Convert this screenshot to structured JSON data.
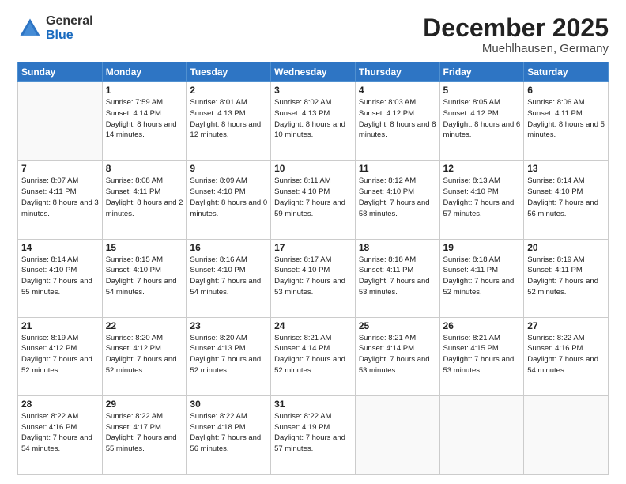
{
  "logo": {
    "general": "General",
    "blue": "Blue"
  },
  "title": "December 2025",
  "location": "Muehlhausen, Germany",
  "days_header": [
    "Sunday",
    "Monday",
    "Tuesday",
    "Wednesday",
    "Thursday",
    "Friday",
    "Saturday"
  ],
  "weeks": [
    [
      {
        "day": "",
        "sunrise": "",
        "sunset": "",
        "daylight": ""
      },
      {
        "day": "1",
        "sunrise": "Sunrise: 7:59 AM",
        "sunset": "Sunset: 4:14 PM",
        "daylight": "Daylight: 8 hours and 14 minutes."
      },
      {
        "day": "2",
        "sunrise": "Sunrise: 8:01 AM",
        "sunset": "Sunset: 4:13 PM",
        "daylight": "Daylight: 8 hours and 12 minutes."
      },
      {
        "day": "3",
        "sunrise": "Sunrise: 8:02 AM",
        "sunset": "Sunset: 4:13 PM",
        "daylight": "Daylight: 8 hours and 10 minutes."
      },
      {
        "day": "4",
        "sunrise": "Sunrise: 8:03 AM",
        "sunset": "Sunset: 4:12 PM",
        "daylight": "Daylight: 8 hours and 8 minutes."
      },
      {
        "day": "5",
        "sunrise": "Sunrise: 8:05 AM",
        "sunset": "Sunset: 4:12 PM",
        "daylight": "Daylight: 8 hours and 6 minutes."
      },
      {
        "day": "6",
        "sunrise": "Sunrise: 8:06 AM",
        "sunset": "Sunset: 4:11 PM",
        "daylight": "Daylight: 8 hours and 5 minutes."
      }
    ],
    [
      {
        "day": "7",
        "sunrise": "Sunrise: 8:07 AM",
        "sunset": "Sunset: 4:11 PM",
        "daylight": "Daylight: 8 hours and 3 minutes."
      },
      {
        "day": "8",
        "sunrise": "Sunrise: 8:08 AM",
        "sunset": "Sunset: 4:11 PM",
        "daylight": "Daylight: 8 hours and 2 minutes."
      },
      {
        "day": "9",
        "sunrise": "Sunrise: 8:09 AM",
        "sunset": "Sunset: 4:10 PM",
        "daylight": "Daylight: 8 hours and 0 minutes."
      },
      {
        "day": "10",
        "sunrise": "Sunrise: 8:11 AM",
        "sunset": "Sunset: 4:10 PM",
        "daylight": "Daylight: 7 hours and 59 minutes."
      },
      {
        "day": "11",
        "sunrise": "Sunrise: 8:12 AM",
        "sunset": "Sunset: 4:10 PM",
        "daylight": "Daylight: 7 hours and 58 minutes."
      },
      {
        "day": "12",
        "sunrise": "Sunrise: 8:13 AM",
        "sunset": "Sunset: 4:10 PM",
        "daylight": "Daylight: 7 hours and 57 minutes."
      },
      {
        "day": "13",
        "sunrise": "Sunrise: 8:14 AM",
        "sunset": "Sunset: 4:10 PM",
        "daylight": "Daylight: 7 hours and 56 minutes."
      }
    ],
    [
      {
        "day": "14",
        "sunrise": "Sunrise: 8:14 AM",
        "sunset": "Sunset: 4:10 PM",
        "daylight": "Daylight: 7 hours and 55 minutes."
      },
      {
        "day": "15",
        "sunrise": "Sunrise: 8:15 AM",
        "sunset": "Sunset: 4:10 PM",
        "daylight": "Daylight: 7 hours and 54 minutes."
      },
      {
        "day": "16",
        "sunrise": "Sunrise: 8:16 AM",
        "sunset": "Sunset: 4:10 PM",
        "daylight": "Daylight: 7 hours and 54 minutes."
      },
      {
        "day": "17",
        "sunrise": "Sunrise: 8:17 AM",
        "sunset": "Sunset: 4:10 PM",
        "daylight": "Daylight: 7 hours and 53 minutes."
      },
      {
        "day": "18",
        "sunrise": "Sunrise: 8:18 AM",
        "sunset": "Sunset: 4:11 PM",
        "daylight": "Daylight: 7 hours and 53 minutes."
      },
      {
        "day": "19",
        "sunrise": "Sunrise: 8:18 AM",
        "sunset": "Sunset: 4:11 PM",
        "daylight": "Daylight: 7 hours and 52 minutes."
      },
      {
        "day": "20",
        "sunrise": "Sunrise: 8:19 AM",
        "sunset": "Sunset: 4:11 PM",
        "daylight": "Daylight: 7 hours and 52 minutes."
      }
    ],
    [
      {
        "day": "21",
        "sunrise": "Sunrise: 8:19 AM",
        "sunset": "Sunset: 4:12 PM",
        "daylight": "Daylight: 7 hours and 52 minutes."
      },
      {
        "day": "22",
        "sunrise": "Sunrise: 8:20 AM",
        "sunset": "Sunset: 4:12 PM",
        "daylight": "Daylight: 7 hours and 52 minutes."
      },
      {
        "day": "23",
        "sunrise": "Sunrise: 8:20 AM",
        "sunset": "Sunset: 4:13 PM",
        "daylight": "Daylight: 7 hours and 52 minutes."
      },
      {
        "day": "24",
        "sunrise": "Sunrise: 8:21 AM",
        "sunset": "Sunset: 4:14 PM",
        "daylight": "Daylight: 7 hours and 52 minutes."
      },
      {
        "day": "25",
        "sunrise": "Sunrise: 8:21 AM",
        "sunset": "Sunset: 4:14 PM",
        "daylight": "Daylight: 7 hours and 53 minutes."
      },
      {
        "day": "26",
        "sunrise": "Sunrise: 8:21 AM",
        "sunset": "Sunset: 4:15 PM",
        "daylight": "Daylight: 7 hours and 53 minutes."
      },
      {
        "day": "27",
        "sunrise": "Sunrise: 8:22 AM",
        "sunset": "Sunset: 4:16 PM",
        "daylight": "Daylight: 7 hours and 54 minutes."
      }
    ],
    [
      {
        "day": "28",
        "sunrise": "Sunrise: 8:22 AM",
        "sunset": "Sunset: 4:16 PM",
        "daylight": "Daylight: 7 hours and 54 minutes."
      },
      {
        "day": "29",
        "sunrise": "Sunrise: 8:22 AM",
        "sunset": "Sunset: 4:17 PM",
        "daylight": "Daylight: 7 hours and 55 minutes."
      },
      {
        "day": "30",
        "sunrise": "Sunrise: 8:22 AM",
        "sunset": "Sunset: 4:18 PM",
        "daylight": "Daylight: 7 hours and 56 minutes."
      },
      {
        "day": "31",
        "sunrise": "Sunrise: 8:22 AM",
        "sunset": "Sunset: 4:19 PM",
        "daylight": "Daylight: 7 hours and 57 minutes."
      },
      {
        "day": "",
        "sunrise": "",
        "sunset": "",
        "daylight": ""
      },
      {
        "day": "",
        "sunrise": "",
        "sunset": "",
        "daylight": ""
      },
      {
        "day": "",
        "sunrise": "",
        "sunset": "",
        "daylight": ""
      }
    ]
  ]
}
